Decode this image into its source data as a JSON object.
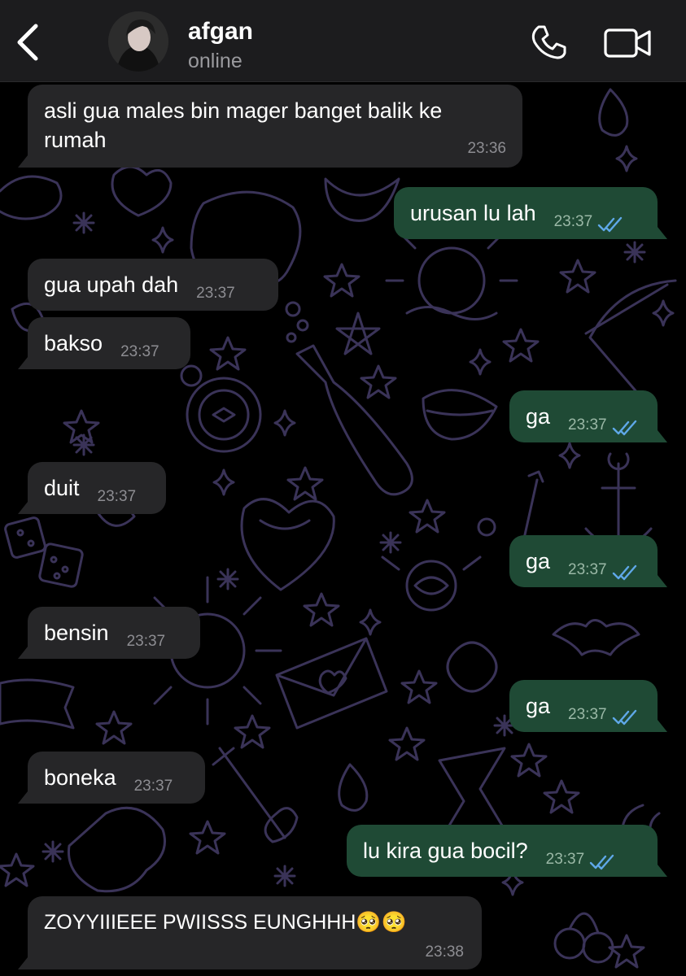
{
  "header": {
    "title": "afgan",
    "status": "online"
  },
  "colors": {
    "background": "#000000",
    "header_bg": "#1c1c1e",
    "incoming_bubble": "#262628",
    "outgoing_bubble": "#1f4a35",
    "read_check": "#5fa8e8",
    "doodle_stroke": "#3a3358"
  },
  "icons": {
    "back": "chevron-left-icon",
    "call": "phone-icon",
    "video": "video-camera-icon",
    "read_receipt": "double-check-icon"
  },
  "messages": [
    {
      "dir": "in",
      "text": "asli gua males bin mager banget balik ke rumah",
      "time": "23:36"
    },
    {
      "dir": "out",
      "text": "urusan lu lah",
      "time": "23:37",
      "read": true
    },
    {
      "dir": "in",
      "text": "gua upah dah",
      "time": "23:37"
    },
    {
      "dir": "in",
      "text": "bakso",
      "time": "23:37"
    },
    {
      "dir": "out",
      "text": "ga",
      "time": "23:37",
      "read": true
    },
    {
      "dir": "in",
      "text": "duit",
      "time": "23:37"
    },
    {
      "dir": "out",
      "text": "ga",
      "time": "23:37",
      "read": true
    },
    {
      "dir": "in",
      "text": "bensin",
      "time": "23:37"
    },
    {
      "dir": "out",
      "text": "ga",
      "time": "23:37",
      "read": true
    },
    {
      "dir": "in",
      "text": "boneka",
      "time": "23:37"
    },
    {
      "dir": "out",
      "text": "lu kira gua bocil?",
      "time": "23:37",
      "read": true
    },
    {
      "dir": "in",
      "text": "ZOYYIIIEEE PWIISSS EUNGHHH🥺🥺",
      "time": "23:38"
    }
  ]
}
